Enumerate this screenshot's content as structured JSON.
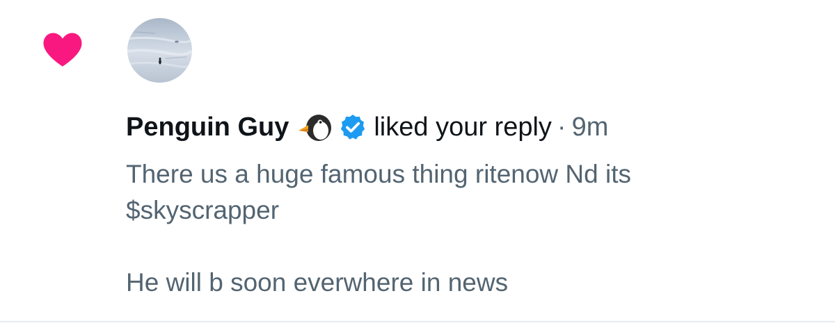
{
  "notification": {
    "type_icon": "heart-icon",
    "user": {
      "display_name": "Penguin Guy",
      "emoji": "penguin-emoji-icon",
      "verified": true,
      "verified_badge_color": "#1d9bf0",
      "avatar": "snowfield-penguin-avatar"
    },
    "action_text": "liked your reply",
    "separator": "·",
    "timestamp": "9m",
    "reply_lines": [
      "There us a huge famous thing ritenow Nd its",
      "$skyscrapper",
      "He will b soon everwhere in news"
    ]
  },
  "colors": {
    "heart": "#f91880",
    "primary_text": "#0f1419",
    "secondary_text": "#536471",
    "verified": "#1d9bf0",
    "divider": "#e7ebef"
  }
}
